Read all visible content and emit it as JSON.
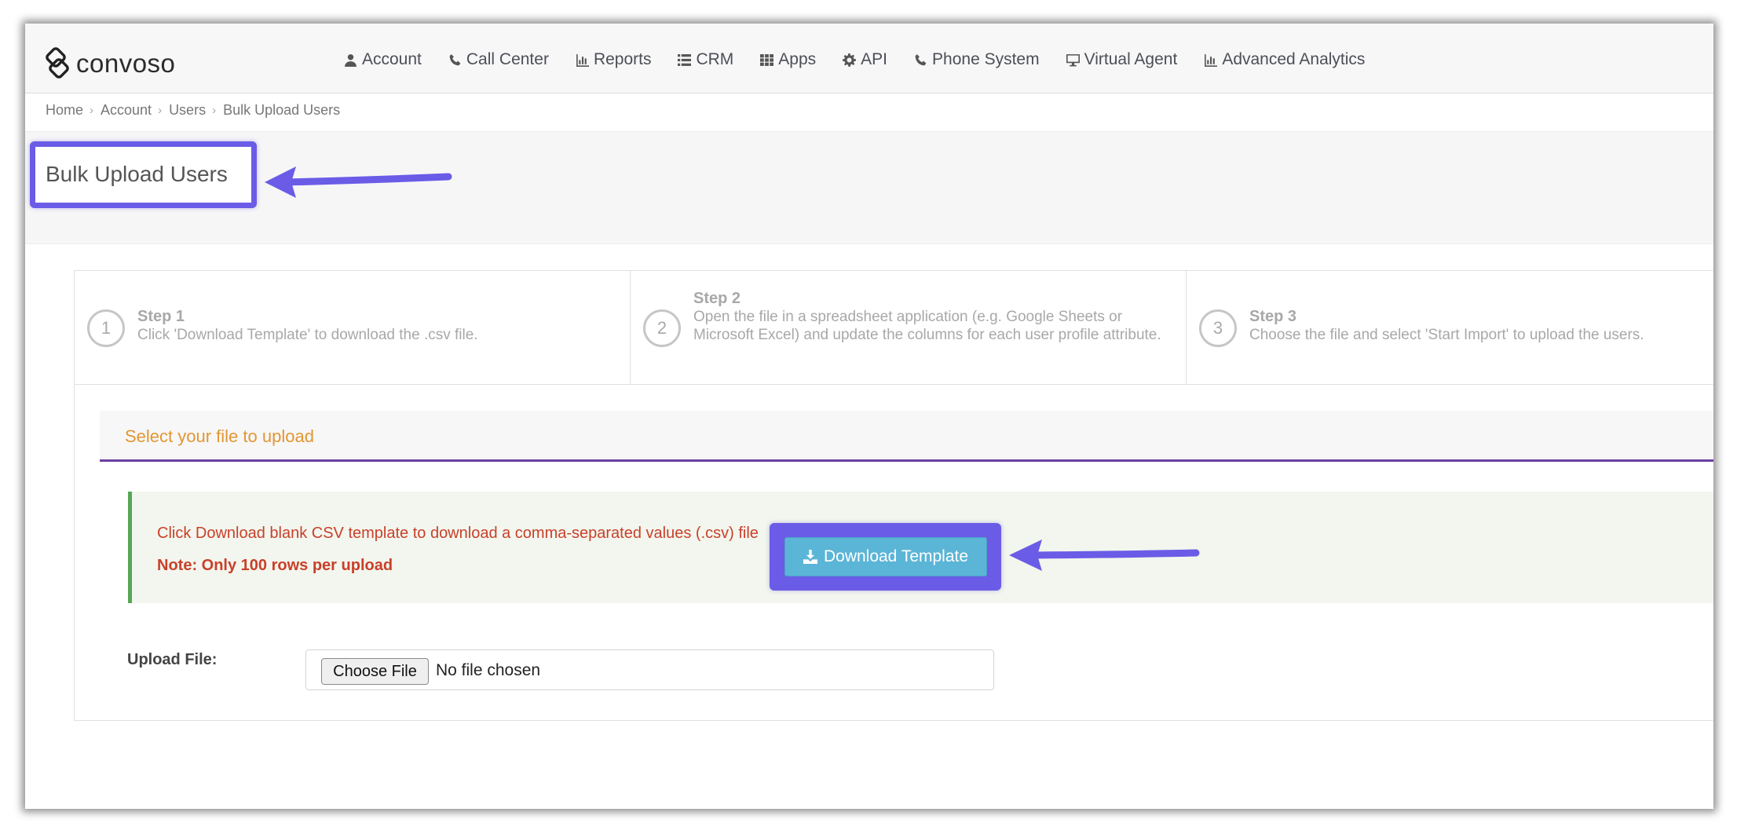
{
  "brand": {
    "name": "convoso"
  },
  "nav": {
    "items": [
      {
        "label": "Account",
        "icon": "user-icon"
      },
      {
        "label": "Call Center",
        "icon": "phone-icon"
      },
      {
        "label": "Reports",
        "icon": "bar-chart-icon"
      },
      {
        "label": "CRM",
        "icon": "list-icon"
      },
      {
        "label": "Apps",
        "icon": "grid-icon"
      },
      {
        "label": "API",
        "icon": "gear-icon"
      },
      {
        "label": "Phone System",
        "icon": "phone-icon"
      },
      {
        "label": "Virtual Agent",
        "icon": "monitor-icon"
      },
      {
        "label": "Advanced Analytics",
        "icon": "bar-chart-icon"
      }
    ]
  },
  "breadcrumb": [
    "Home",
    "Account",
    "Users",
    "Bulk Upload Users"
  ],
  "page": {
    "title": "Bulk Upload Users"
  },
  "steps": [
    {
      "number": "1",
      "title": "Step 1",
      "description": "Click 'Download Template' to download the .csv file."
    },
    {
      "number": "2",
      "title": "Step 2",
      "description": "Open the file in a spreadsheet application (e.g. Google Sheets or Microsoft Excel) and update the columns for each user profile attribute."
    },
    {
      "number": "3",
      "title": "Step 3",
      "description": "Choose the file and select 'Start Import' to upload the users."
    }
  ],
  "upload": {
    "section_title": "Select your file to upload",
    "alert_text": "Click Download blank CSV template to download a comma-separated values (.csv) file",
    "note": "Note: Only 100 rows per upload",
    "download_button": "Download Template",
    "file_label": "Upload File:",
    "choose_button": "Choose File",
    "no_file_text": "No file chosen"
  },
  "colors": {
    "highlight": "#6a5ce6",
    "button": "#5bb5d6",
    "section_title": "#e39632",
    "alert_text": "#c9402a",
    "section_rule": "#6b3fa0"
  }
}
